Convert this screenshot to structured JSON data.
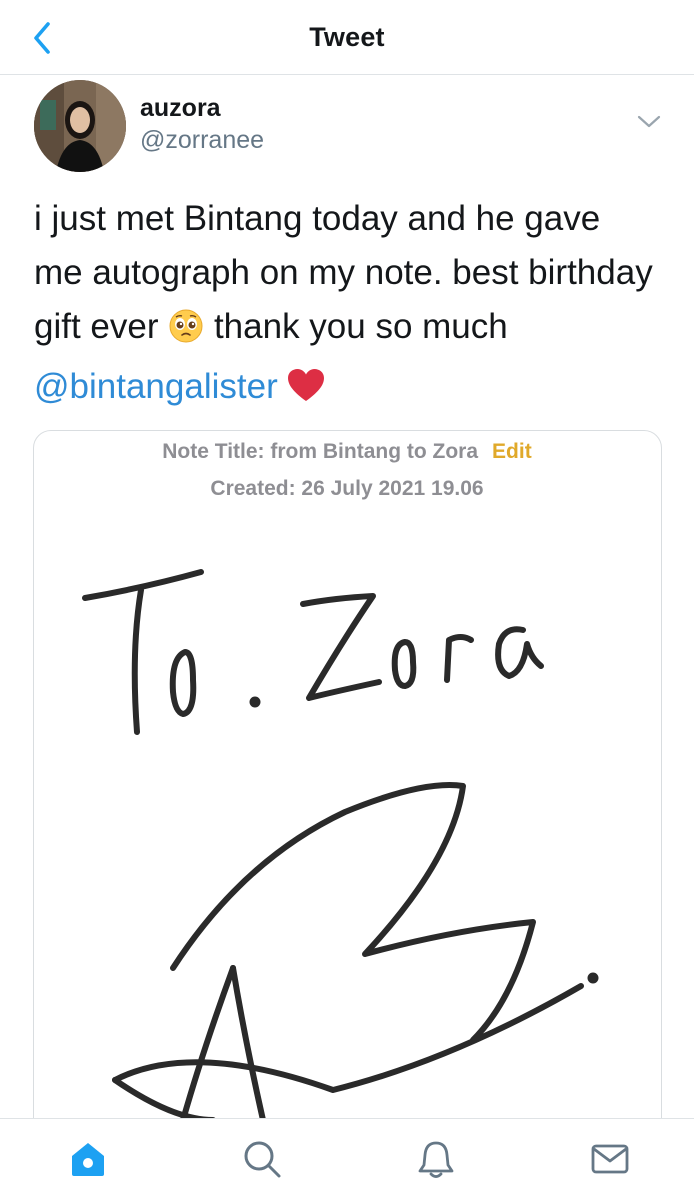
{
  "header": {
    "title": "Tweet",
    "back_icon": "chevron-left-icon"
  },
  "tweet": {
    "author_name": "auzora",
    "author_handle": "@zorranee",
    "text_part1": "i just met Bintang today and he gave me autograph on my note. best birthday gift ever ",
    "emoji1": "pleading-face-emoji",
    "text_part2": " thank you so much ",
    "mention": "@bintangalister",
    "emoji2": "red-heart-emoji"
  },
  "note": {
    "title": "Note Title: from Bintang to Zora",
    "edit_label": "Edit",
    "created": "Created: 26 July 2021 19.06",
    "handwritten_text": "To. Zora"
  },
  "tabs": [
    {
      "icon": "home-icon",
      "active": true
    },
    {
      "icon": "search-icon",
      "active": false
    },
    {
      "icon": "bell-icon",
      "active": false
    },
    {
      "icon": "mail-icon",
      "active": false
    }
  ],
  "colors": {
    "accent": "#1da1f2",
    "mention": "#2f8bd6",
    "edit": "#e0a92a",
    "secondary_text": "#657786"
  }
}
